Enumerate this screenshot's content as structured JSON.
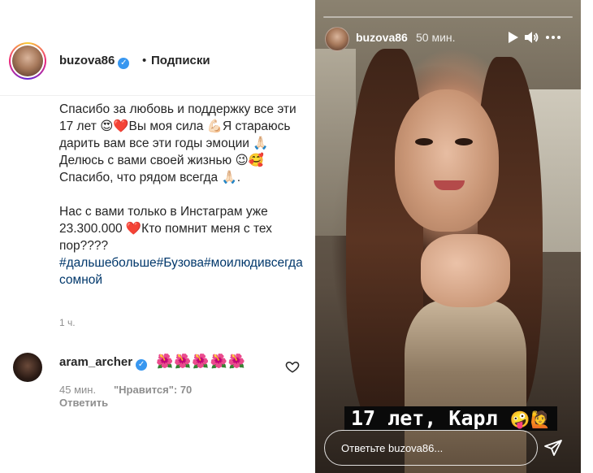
{
  "post": {
    "header": {
      "username": "buzova86",
      "verified_mark": "✓",
      "separator": "•",
      "follow_label": "Подписки"
    },
    "caption": {
      "text": "Спасибо за любовь и поддержку все эти 17 лет 😍❤️Вы моя сила 💪🏻Я стараюсь дарить вам все эти годы эмоции 🙏🏻Делюсь с вами своей жизнью 😉🥰Спасибо, что рядом всегда 🙏🏻.",
      "text2": "Нас с вами только в Инстаграм уже 23.300.000 ❤️Кто помнит меня с тех пор????",
      "hashtags": "#дальшебольше#Бузова#моилюдивсегдасомной"
    },
    "time": "1 ч.",
    "comment": {
      "username": "aram_archer",
      "verified_mark": "✓",
      "text": "🌺🌺🌺🌺🌺",
      "time": "45 мин.",
      "likes": "\"Нравится\": 70",
      "reply_label": "Ответить",
      "like_icon": "heart-outline-icon"
    }
  },
  "story": {
    "username": "buzova86",
    "time": "50 мин.",
    "progress": 0.0,
    "controls": [
      "play-icon",
      "volume-icon",
      "more-icon"
    ],
    "overlay_text": "17 лет, Карл",
    "overlay_emoji": "🤪🙋",
    "reply_placeholder": "Ответьте buzova86...",
    "send_icon": "send-icon"
  },
  "colors": {
    "verified": "#3897f0",
    "hashtag": "#00376b",
    "muted": "#8e8e8e",
    "text": "#262626"
  }
}
